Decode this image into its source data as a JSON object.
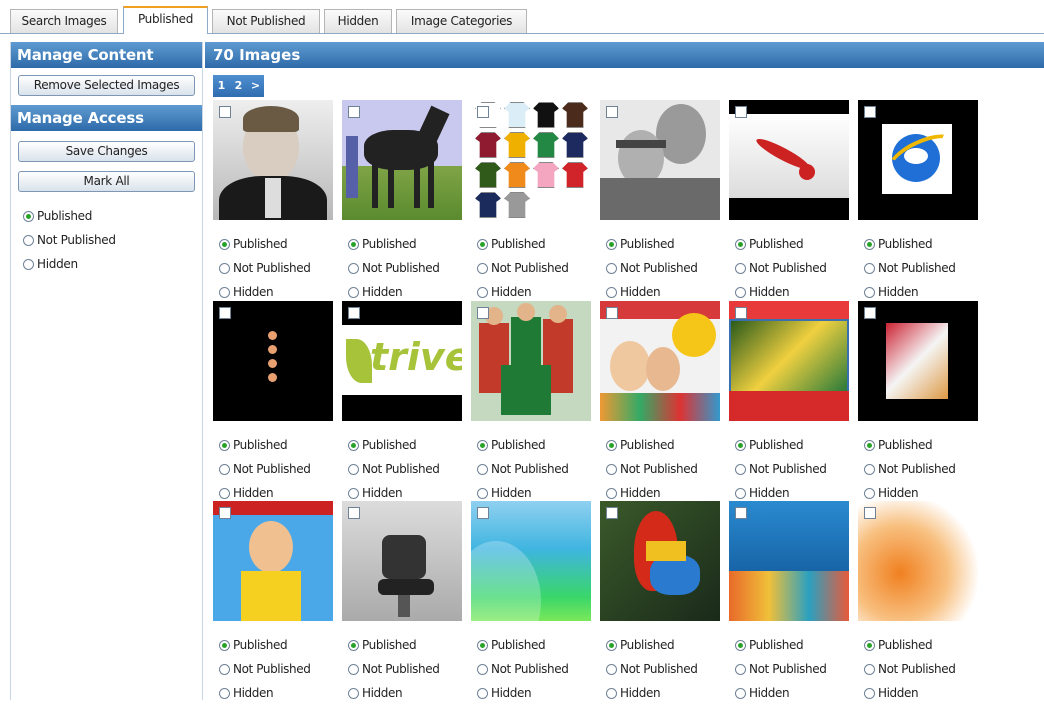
{
  "tabs": [
    "Search Images",
    "Published",
    "Not Published",
    "Hidden",
    "Image Categories"
  ],
  "sidebar": {
    "manage_content": "Manage Content",
    "remove_button": "Remove Selected Images",
    "manage_access": "Manage Access",
    "save_button": "Save Changes",
    "mark_all_button": "Mark All",
    "radios": [
      "Published",
      "Not Published",
      "Hidden"
    ],
    "selected_radio": "Published"
  },
  "main": {
    "title": "70 Images",
    "pager": [
      "1",
      "2",
      ">"
    ],
    "current_page": "1",
    "option_labels": [
      "Published",
      "Not Published",
      "Hidden"
    ]
  },
  "images": [
    {
      "subject": "man in suit portrait",
      "status": "Published"
    },
    {
      "subject": "black horse",
      "status": "Published"
    },
    {
      "subject": "colored t-shirts",
      "status": "Published"
    },
    {
      "subject": "two men portrait",
      "status": "Published"
    },
    {
      "subject": "red bowling pin",
      "status": "Published"
    },
    {
      "subject": "internet explorer logo",
      "status": "Published"
    },
    {
      "subject": "flower dots on black",
      "status": "Published"
    },
    {
      "subject": "trive logo",
      "status": "Published"
    },
    {
      "subject": "group of men in green",
      "status": "Published"
    },
    {
      "subject": "magazine cover kids",
      "status": "Published"
    },
    {
      "subject": "magazine cover kryss",
      "status": "Published"
    },
    {
      "subject": "magazine on black",
      "status": "Published"
    },
    {
      "subject": "magazine cover woman",
      "status": "Published"
    },
    {
      "subject": "dentist chair",
      "status": "Published"
    },
    {
      "subject": "green blue abstract",
      "status": "Published"
    },
    {
      "subject": "red parrot",
      "status": "Published"
    },
    {
      "subject": "coral reef fish",
      "status": "Published"
    },
    {
      "subject": "orange dots abstract",
      "status": "Published"
    }
  ],
  "colors": {
    "header_blue": "#2e6aa9",
    "tab_active_accent": "#f0a020",
    "radio_on": "#2aa22a"
  }
}
